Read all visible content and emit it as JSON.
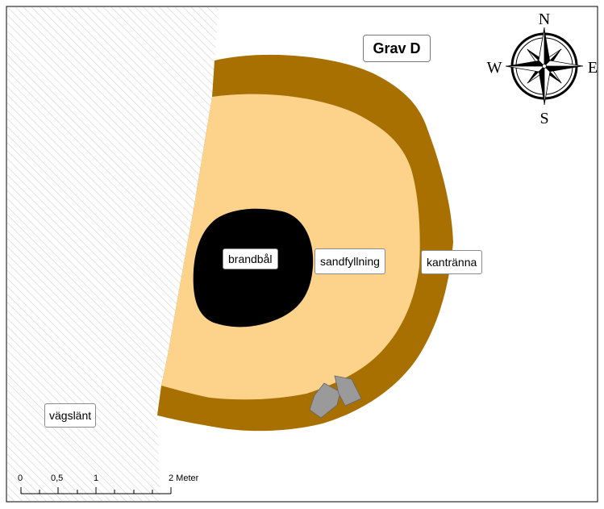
{
  "title": "Grav D",
  "labels": {
    "brandbal": "brandbål",
    "sandfyllning": "sandfyllning",
    "kantranna": "kantränna",
    "vagslant": "vägslänt"
  },
  "compass": {
    "n": "N",
    "s": "S",
    "e": "E",
    "w": "W"
  },
  "scalebar": {
    "t0": "0",
    "t1": "0,5",
    "t2": "1",
    "t3": "2 Meter"
  },
  "colors": {
    "kantranna": "#a87000",
    "sandfyllning": "#fdd28a",
    "brandbal": "#000000",
    "stones": "#9a9a9a",
    "vagslant_hatch": "#d0d0d0"
  }
}
